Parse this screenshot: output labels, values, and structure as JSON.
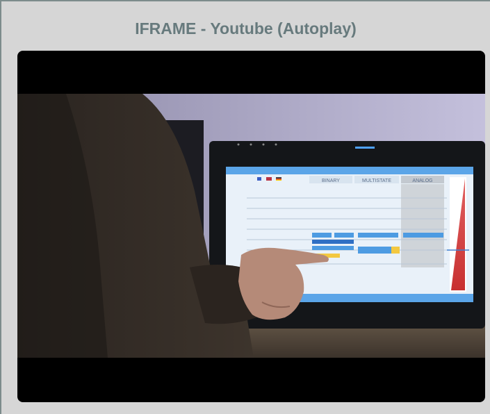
{
  "widget": {
    "title": "IFRAME - Youtube (Autoplay)"
  },
  "video": {
    "icon": "youtube-video-frame",
    "screen_ui": {
      "columns": [
        "BINARY",
        "MULTISTATE",
        "ANALOG"
      ],
      "set_off_label": "Set OFF",
      "set_on_label": "Set ON"
    }
  }
}
